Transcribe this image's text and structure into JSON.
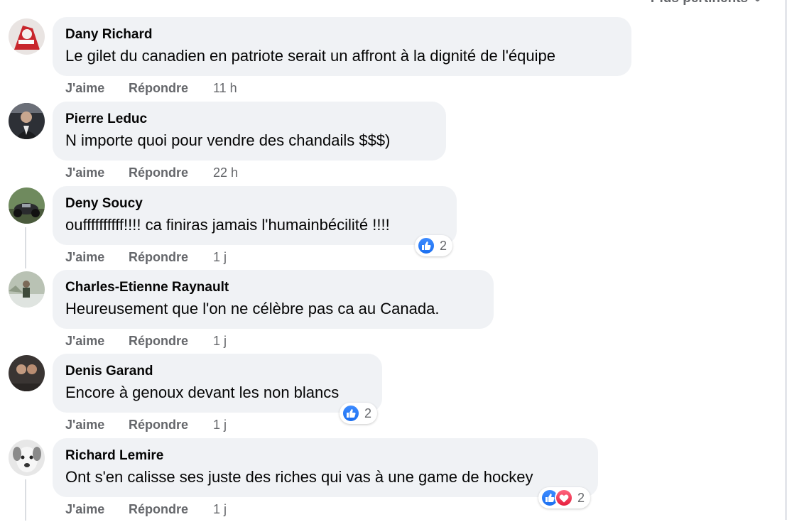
{
  "sort": {
    "label": "Plus pertinents",
    "icon": "chevron-down-icon"
  },
  "action_labels": {
    "like": "J'aime",
    "reply": "Répondre"
  },
  "comments": [
    {
      "author": "Dany Richard",
      "text": "Le gilet du canadien en patriote serait un affront à la dignité de l'équipe",
      "time": "11 h"
    },
    {
      "author": "Pierre Leduc",
      "text": "N importe quoi pour vendre des chandails $$$)",
      "time": "22 h"
    },
    {
      "author": "Deny Soucy",
      "text": "ouffffffffff!!!! ca finiras jamais l'humainbécilité !!!!",
      "time": "1 j",
      "reactions": {
        "types": [
          "like"
        ],
        "count": "2"
      }
    },
    {
      "author": "Charles-Etienne Raynault",
      "text": "Heureusement que l'on ne célèbre pas ca au Canada.",
      "time": "1 j"
    },
    {
      "author": "Denis Garand",
      "text": "Encore à genoux devant les non blancs",
      "time": "1 j",
      "reactions": {
        "types": [
          "like"
        ],
        "count": "2"
      }
    },
    {
      "author": "Richard Lemire",
      "text": "Ont s'en calisse ses juste des riches qui vas à une game de hockey",
      "time": "1 j",
      "reactions": {
        "types": [
          "like",
          "love"
        ],
        "count": "2"
      }
    }
  ],
  "colors": {
    "like": "#1877f2",
    "love": "#f33e58",
    "bubble": "#f0f2f5",
    "meta_text": "#65676b"
  }
}
